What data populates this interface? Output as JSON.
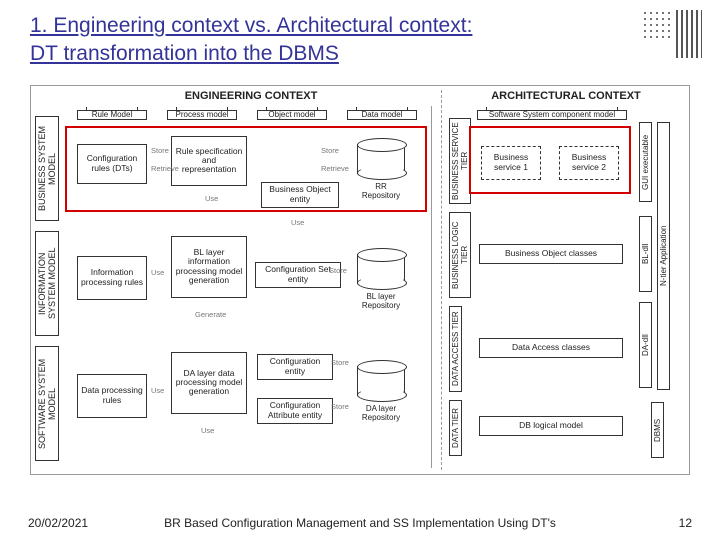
{
  "title_line1": "1. Engineering context vs. Architectural context:",
  "title_line2": "DT transformation into the DBMS",
  "eng_title": "ENGINEERING CONTEXT",
  "arch_title": "ARCHITECTURAL CONTEXT",
  "vrows": {
    "bsm": "BUSINESS SYSTEM\nMODEL",
    "ism": "INFORMATION SYSTEM\nMODEL",
    "ssm": "SOFTWARE SYSTEM\nMODEL",
    "bst": "BUSINESS SERVICE\nTIER",
    "blt": "BUSINESS LOGIC\nTIER",
    "dat": "DATA ACCESS\nTIER",
    "dt": "DATA\nTIER"
  },
  "colhdr": {
    "rule": "Rule Model",
    "process": "Process model",
    "object": "Object model",
    "data": "Data model",
    "sscm": "Software System component model"
  },
  "boxes": {
    "config_rules": "Configuration\nrules (DTs)",
    "rule_spec": "Rule\nspecification and\nrepresentation",
    "bo_entity": "Business Object\nentity",
    "bl_proc": "BL layer\ninformation\nprocessing\nmodel\ngeneration",
    "info_rules": "Information\nprocessing\nrules",
    "cfg_set": "Configuration Set\nentity",
    "da_proc": "DA layer data\nprocessing\nmodel\ngeneration",
    "data_rules": "Data\nprocessing\nrules",
    "cfg_entity": "Configuration\nentity",
    "cfg_attr": "Configuration\nAttribute entity",
    "bs1": "Business\nservice 1",
    "bs2": "Business\nservice 2",
    "bo_classes": "Business Object classes",
    "da_classes": "Data Access classes",
    "db_logical": "DB logical model"
  },
  "cyls": {
    "rr": "RR\nRepository",
    "bl": "BL layer\nRepository",
    "da": "DA layer\nRepository"
  },
  "tiny": {
    "store": "Store",
    "retrieve": "Retrieve",
    "use": "Use",
    "generate": "Generate"
  },
  "vright": {
    "gui": "GUI executable",
    "bldll": "BL-dll",
    "ntier": "N-tier Application",
    "dadll": "DA-dll",
    "dbms": "DBMS"
  },
  "footer": {
    "date": "20/02/2021",
    "title": "BR Based Configuration Management and SS Implementation Using DT's",
    "page": "12"
  }
}
